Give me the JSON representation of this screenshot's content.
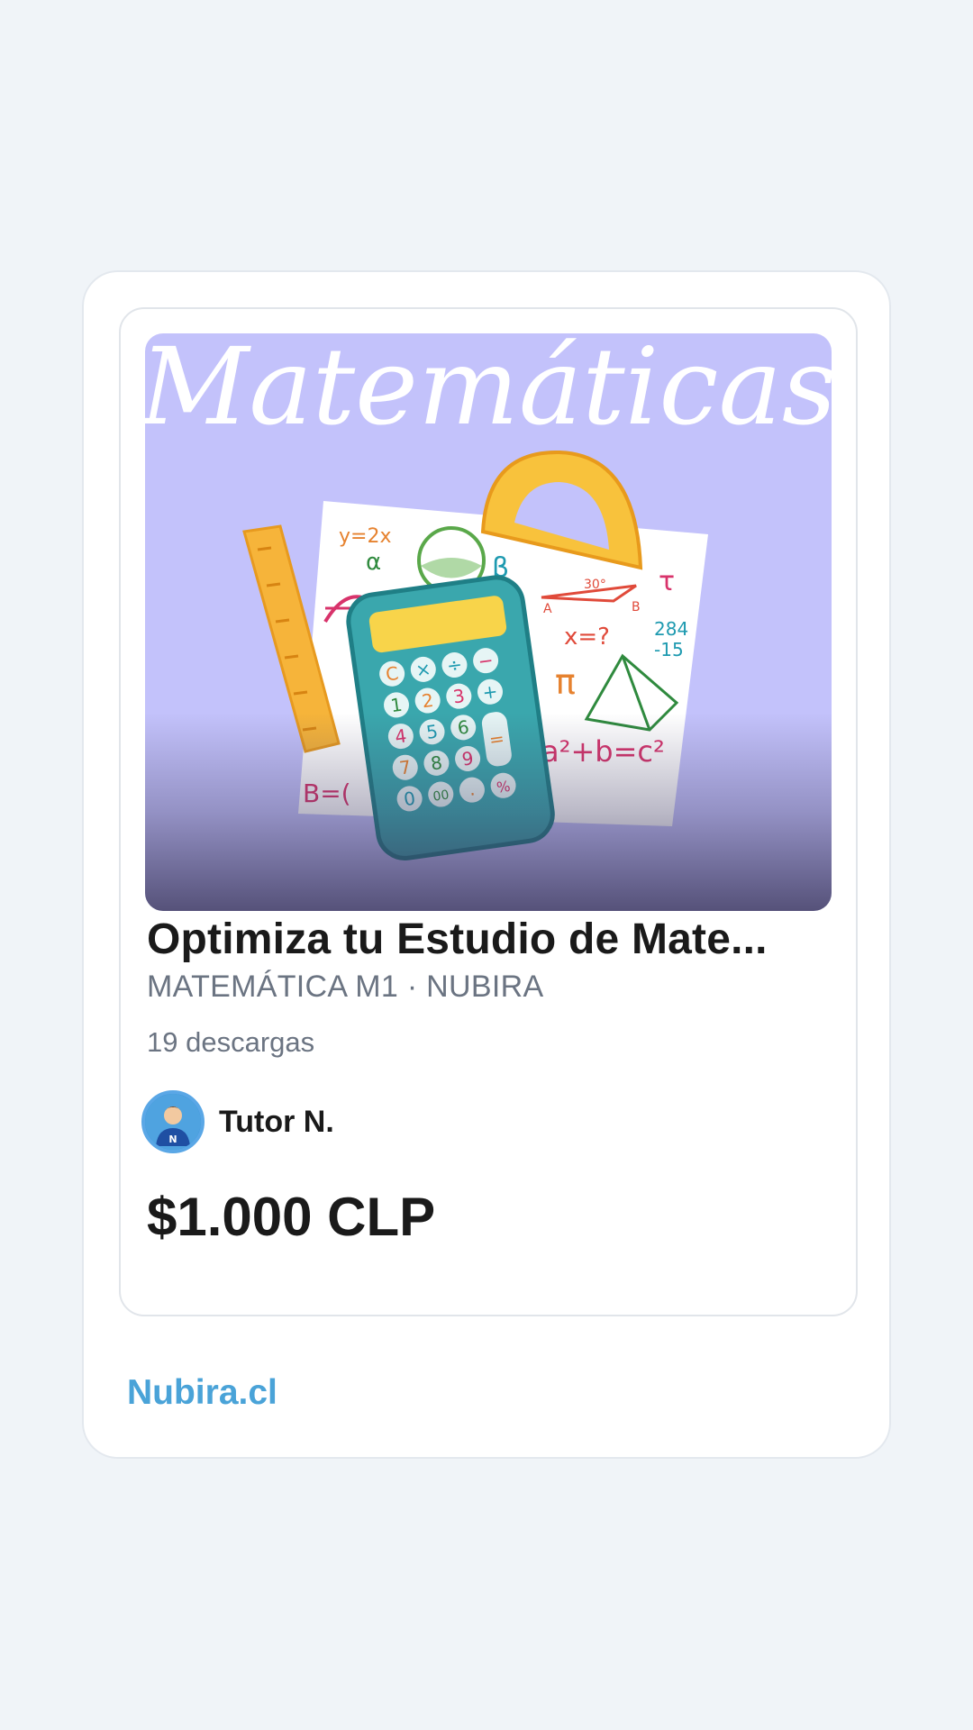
{
  "product": {
    "cover_text": "Matemáticas",
    "title": "Optimiza tu Estudio de Mate...",
    "subject_line": "MATEMÁTICA M1 · NUBIRA",
    "downloads": "19 descargas",
    "author_name": "Tutor N.",
    "price": "$1.000 CLP"
  },
  "footer": {
    "brand_link": "Nubira.cl"
  },
  "colors": {
    "page_background": "#f0f4f8",
    "cover_background": "#c3c2fb",
    "brand_link": "#4aa3d8"
  }
}
